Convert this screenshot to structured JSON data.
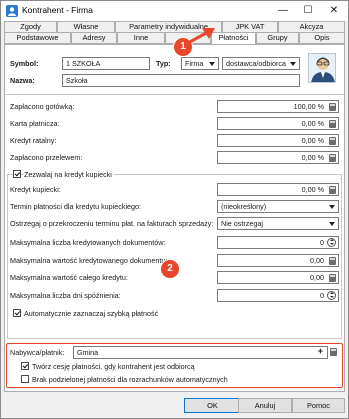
{
  "window": {
    "title": "Kontrahent - Firma",
    "minimize": "—",
    "maximize": "☐",
    "close": "✕"
  },
  "tabs_row1": [
    "Zgody",
    "Własne",
    "Parametry indywidualne",
    "JPK VAT",
    "Akcyza"
  ],
  "tabs_row2": [
    "Podstawowe",
    "Adresy",
    "Inne",
    "",
    "Płatności",
    "Grupy",
    "Opis"
  ],
  "active_tab": "Płatności",
  "header": {
    "symbol_label": "Symbol:",
    "symbol_value": "1 SZKOŁA",
    "typ_label": "Typ:",
    "typ_value": "Firma",
    "role_value": "dostawca/odbiorca",
    "nazwa_label": "Nazwa:",
    "nazwa_value": "Szkoła"
  },
  "payments": [
    {
      "label": "Zapłacono gotówką:",
      "value": "100,00 %"
    },
    {
      "label": "Karta płatnicza:",
      "value": "0,00 %"
    },
    {
      "label": "Kredyt ratalny:",
      "value": "0,00 %"
    },
    {
      "label": "Zapłacono przelewem:",
      "value": "0,00 %"
    }
  ],
  "credit": {
    "allow_label": "Zezwalaj na kredyt kupiecki",
    "allow_checked": true,
    "rows": [
      {
        "label": "Kredyt kupiecki:",
        "value": "0,00 %"
      },
      {
        "label": "Termin płatności dla kredytu kupieckiego:",
        "value": "(nieokreślony)"
      },
      {
        "label": "Ostrzegaj o przekroczeniu terminu płat. na fakturach sprzedaży:",
        "value": "Nie ostrzegaj"
      },
      {
        "label": "Maksymalna liczba kredytowanych dokumentów:",
        "value": "0"
      },
      {
        "label": "Maksymalna wartość kredytowanego dokumentu:",
        "value": "0,00"
      },
      {
        "label": "Maksymalna wartość całego kredytu:",
        "value": "0,00"
      },
      {
        "label": "Maksymalna liczba dni spóźnienia:",
        "value": "0"
      }
    ],
    "auto_label": "Automatycznie zaznaczaj szybką płatność",
    "auto_checked": true
  },
  "payer": {
    "label": "Nabywca/płatnik:",
    "value": "Gmina",
    "plus": "+",
    "split_label": "Twórz cesję płatności, gdy kontrahent jest odbiorcą",
    "split_checked": true,
    "nosplit_label": "Brak podzielonej płatności dla rozrachunków automatycznych",
    "nosplit_checked": false
  },
  "annotations": {
    "badge1": "1",
    "badge2": "2",
    "accent": "#e9462b"
  },
  "buttons": {
    "ok": "OK",
    "cancel": "Anuluj",
    "help": "Pomoc"
  }
}
